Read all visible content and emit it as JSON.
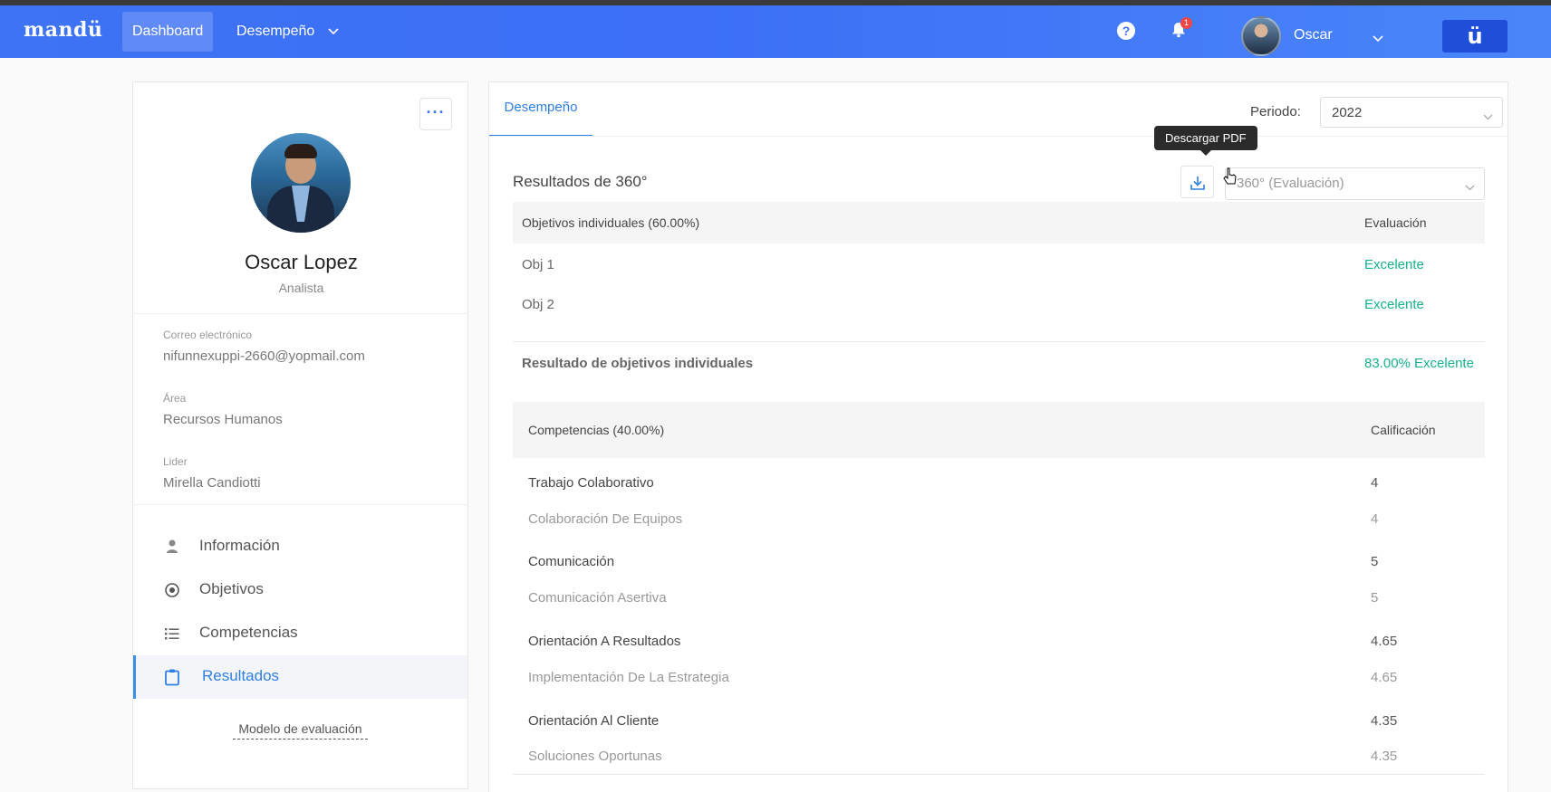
{
  "nav": {
    "brand": "mandü",
    "dashboard": "Dashboard",
    "desempeno": "Desempeño",
    "notifications_count": "1",
    "help": "?",
    "user_name": "Oscar",
    "logo_button": "ü"
  },
  "profile": {
    "more": "···",
    "name": "Oscar Lopez",
    "role": "Analista",
    "email_label": "Correo electrónico",
    "email": "nifunnexuppi-2660@yopmail.com",
    "area_label": "Área",
    "area": "Recursos Humanos",
    "leader_label": "Lider",
    "leader": "Mirella Candiotti",
    "menu": [
      {
        "label": "Información",
        "icon": "user-icon"
      },
      {
        "label": "Objetivos",
        "icon": "target-icon"
      },
      {
        "label": "Competencias",
        "icon": "list-icon"
      },
      {
        "label": "Resultados",
        "icon": "clipboard-icon"
      }
    ],
    "modelo_link": "Modelo de evaluación"
  },
  "main": {
    "tab": "Desempeño",
    "periodo_label": "Periodo:",
    "periodo_value": "2022",
    "section_title": "Resultados de 360°",
    "tooltip": "Descargar PDF",
    "eval_select": "360° (Evaluación)",
    "objectives": {
      "header_left": "Objetivos individuales (60.00%)",
      "header_right": "Evaluación",
      "rows": [
        {
          "name": "Obj 1",
          "value": "Excelente"
        },
        {
          "name": "Obj 2",
          "value": "Excelente"
        }
      ],
      "result_label": "Resultado de objetivos individuales",
      "result_value": "83.00% Excelente"
    },
    "competencies": {
      "header_left": "Competencias (40.00%)",
      "header_right": "Calificación",
      "rows": [
        {
          "name": "Trabajo Colaborativo",
          "value": "4",
          "sub_name": "Colaboración De Equipos",
          "sub_value": "4"
        },
        {
          "name": "Comunicación",
          "value": "5",
          "sub_name": "Comunicación Asertiva",
          "sub_value": "5"
        },
        {
          "name": "Orientación A Resultados",
          "value": "4.65",
          "sub_name": "Implementación De La Estrategia",
          "sub_value": "4.65"
        },
        {
          "name": "Orientación Al Cliente",
          "value": "4.35",
          "sub_name": "Soluciones Oportunas",
          "sub_value": "4.35"
        }
      ]
    }
  },
  "colors": {
    "primary": "#3e73f4",
    "accent_green": "#17b18f",
    "active_blue": "#2f80e0"
  }
}
